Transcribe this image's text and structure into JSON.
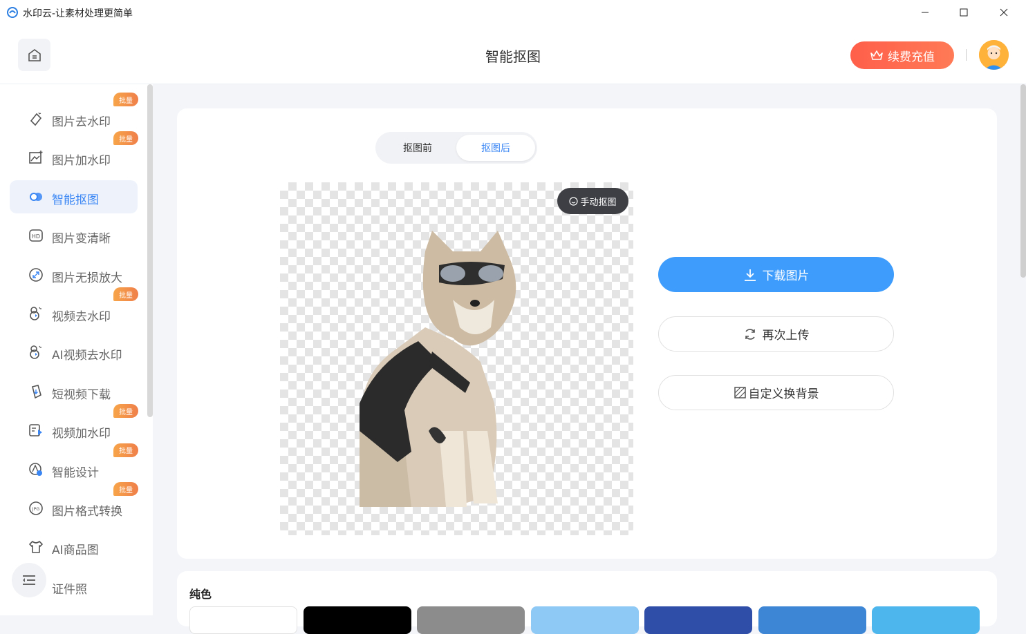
{
  "window": {
    "title": "水印云-让素材处理更简单",
    "controls": [
      "minimize",
      "maximize",
      "close"
    ]
  },
  "header": {
    "title": "智能抠图",
    "vip_label": "续费充值"
  },
  "sidebar": {
    "badge_text": "批量",
    "items": [
      {
        "label": "图片去水印",
        "icon": "eraser-icon",
        "badge": true,
        "active": false
      },
      {
        "label": "图片加水印",
        "icon": "image-add-icon",
        "badge": true,
        "active": false
      },
      {
        "label": "智能抠图",
        "icon": "cutout-icon",
        "badge": false,
        "active": true
      },
      {
        "label": "图片变清晰",
        "icon": "hd-icon",
        "badge": false,
        "active": false
      },
      {
        "label": "图片无损放大",
        "icon": "expand-icon",
        "badge": false,
        "active": false
      },
      {
        "label": "视频去水印",
        "icon": "video-eraser-icon",
        "badge": true,
        "active": false
      },
      {
        "label": "AI视频去水印",
        "icon": "ai-video-icon",
        "badge": false,
        "active": false
      },
      {
        "label": "短视频下载",
        "icon": "download-video-icon",
        "badge": false,
        "active": false
      },
      {
        "label": "视频加水印",
        "icon": "video-add-icon",
        "badge": true,
        "active": false
      },
      {
        "label": "智能设计",
        "icon": "design-icon",
        "badge": true,
        "active": false
      },
      {
        "label": "图片格式转换",
        "icon": "jpg-icon",
        "badge": true,
        "active": false
      },
      {
        "label": "AI商品图",
        "icon": "shirt-icon",
        "badge": false,
        "active": false
      },
      {
        "label": "证件照",
        "icon": "id-photo-icon",
        "badge": false,
        "active": false
      }
    ]
  },
  "main": {
    "toggle": {
      "before": "抠图前",
      "after": "抠图后",
      "selected": "after"
    },
    "manual_cutout": "手动抠图",
    "actions": {
      "download": "下载图片",
      "reupload": "再次上传",
      "custom_bg": "自定义换背景"
    }
  },
  "colors_panel": {
    "title": "纯色",
    "swatches": [
      "#ffffff",
      "#000000",
      "#8c8c8c",
      "#8ec8f4",
      "#2f4ea8",
      "#3d86d6",
      "#4db6ec"
    ]
  },
  "accent": {
    "primary": "#3e9dfc",
    "vip": "#ff6a4f",
    "badge": "#f29a4a"
  }
}
